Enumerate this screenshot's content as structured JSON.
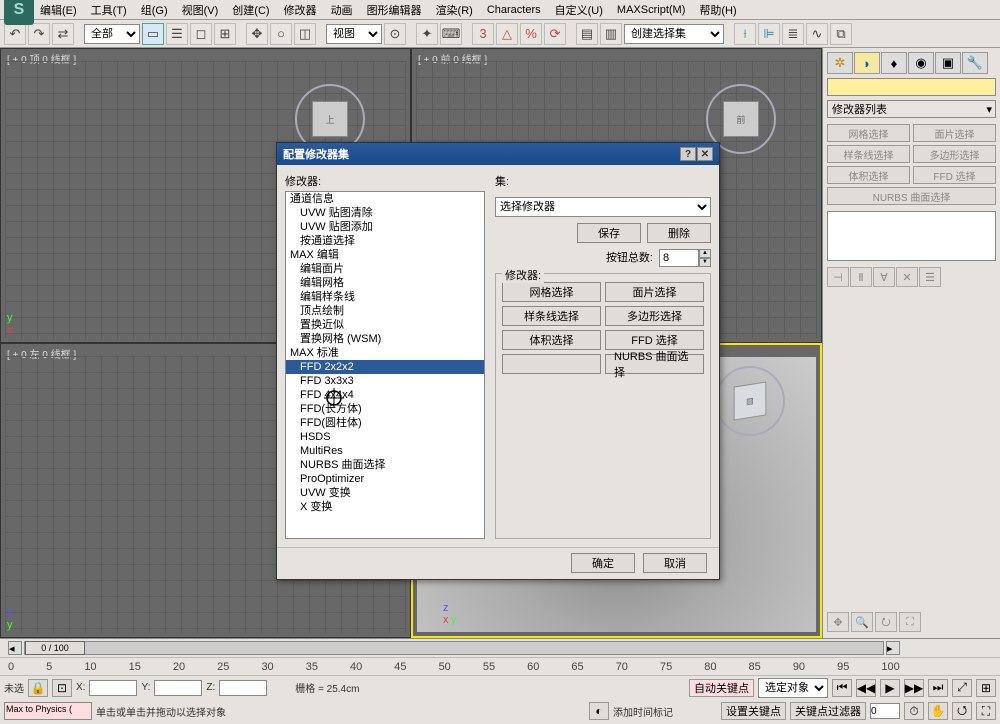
{
  "app_icon_letter": "S",
  "menu": {
    "edit": "编辑(E)",
    "tools": "工具(T)",
    "group": "组(G)",
    "views": "视图(V)",
    "create": "创建(C)",
    "modifiers": "修改器",
    "animation": "动画",
    "graph_editors": "图形编辑器",
    "rendering": "渲染(R)",
    "characters": "Characters",
    "customize": "自定义(U)",
    "maxscript": "MAXScript(M)",
    "help": "帮助(H)"
  },
  "toolbar": {
    "filter_all": "全部",
    "view_label": "视图",
    "selection_set": "创建选择集"
  },
  "viewports": {
    "top": "[ + 0 顶 0 线框 ]",
    "front": "[ + 0 前 0 线框 ]",
    "left": "[ + 0 左 0 线框 ]",
    "persp": ""
  },
  "right_panel": {
    "modifier_list": "修改器列表",
    "buttons": {
      "mesh_select": "网格选择",
      "patch_select": "面片选择",
      "spline_select": "样条线选择",
      "poly_select": "多边形选择",
      "vol_select": "体积选择",
      "ffd_select": "FFD 选择",
      "nurbs_select": "NURBS 曲面选择"
    }
  },
  "dialog": {
    "title": "配置修改器集",
    "modifiers_label": "修改器:",
    "sets_label": "集:",
    "set_select_value": "选择修改器",
    "save": "保存",
    "delete": "删除",
    "button_total_label": "按钮总数:",
    "button_total_value": "8",
    "modifiers_group_label": "修改器:",
    "list": [
      {
        "t": "通道信息",
        "i": 0
      },
      {
        "t": "UVW 贴图清除",
        "i": 1
      },
      {
        "t": "UVW 贴图添加",
        "i": 1
      },
      {
        "t": "按通道选择",
        "i": 1
      },
      {
        "t": "MAX 编辑",
        "i": 0
      },
      {
        "t": "编辑面片",
        "i": 1
      },
      {
        "t": "编辑网格",
        "i": 1
      },
      {
        "t": "编辑样条线",
        "i": 1
      },
      {
        "t": "顶点绘制",
        "i": 1
      },
      {
        "t": "置换近似",
        "i": 1
      },
      {
        "t": "置换网格 (WSM)",
        "i": 1
      },
      {
        "t": "MAX 标准",
        "i": 0
      },
      {
        "t": "FFD 2x2x2",
        "i": 1,
        "sel": true
      },
      {
        "t": "FFD 3x3x3",
        "i": 1
      },
      {
        "t": "FFD 4x4x4",
        "i": 1
      },
      {
        "t": "FFD(长方体)",
        "i": 1
      },
      {
        "t": "FFD(圆柱体)",
        "i": 1
      },
      {
        "t": "HSDS",
        "i": 1
      },
      {
        "t": "MultiRes",
        "i": 1
      },
      {
        "t": "NURBS 曲面选择",
        "i": 1
      },
      {
        "t": "ProOptimizer",
        "i": 1
      },
      {
        "t": "UVW 变换",
        "i": 1
      },
      {
        "t": "X 变换",
        "i": 1
      }
    ],
    "grid_buttons": {
      "mesh_select": "网格选择",
      "patch_select": "面片选择",
      "spline_select": "样条线选择",
      "poly_select": "多边形选择",
      "vol_select": "体积选择",
      "ffd_select": "FFD 选择",
      "nurbs_select": "NURBS 曲面选择"
    },
    "ok": "确定",
    "cancel": "取消"
  },
  "timeline": {
    "thumb": "0 / 100",
    "ticks": [
      "0",
      "5",
      "10",
      "15",
      "20",
      "25",
      "30",
      "35",
      "40",
      "45",
      "50",
      "55",
      "60",
      "65",
      "70",
      "75",
      "80",
      "85",
      "90",
      "95",
      "100"
    ]
  },
  "status": {
    "none_selected": "未选",
    "x_label": "X:",
    "y_label": "Y:",
    "z_label": "Z:",
    "grid_info": "栅格 = 25.4cm",
    "auto_key": "自动关键点",
    "selected_obj": "选定对象",
    "set_key": "设置关键点",
    "key_filters": "关键点过滤器",
    "add_time_tag": "添加时间标记",
    "script_box": "Max to Physics (",
    "prompt": "单击或单击并拖动以选择对象"
  }
}
